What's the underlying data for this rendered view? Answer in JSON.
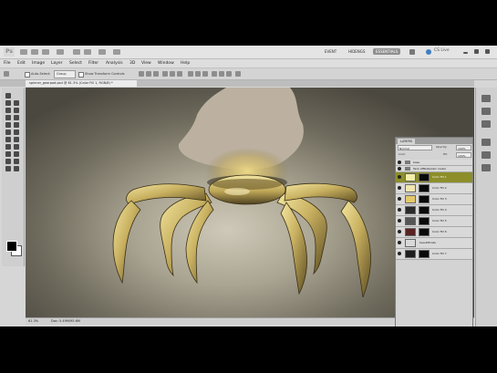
{
  "app": {
    "logo": "Ps",
    "workspaces": [
      "EVENT",
      "HIDENGS",
      "ESSENTIALS"
    ],
    "active_workspace": "ESSENTIALS",
    "cs_live": "CS Live"
  },
  "menu": [
    "File",
    "Edit",
    "Image",
    "Layer",
    "Select",
    "Filter",
    "Analysis",
    "3D",
    "View",
    "Window",
    "Help"
  ],
  "options": {
    "auto_select_label": "Auto-Select:",
    "auto_select_value": "Group",
    "show_transform_label": "Show Transform Controls"
  },
  "document": {
    "tab_title": "spinner_gearpad.psd @ 61.3% (Color Fill 1, RGB/8) *",
    "zoom": "61.3%",
    "doc_info": "Doc: 5.49M/95.6M"
  },
  "layers_panel": {
    "tab": "LAYERS",
    "blend_mode": "Normal",
    "opacity_label": "Opacity:",
    "opacity_value": "100%",
    "lock_label": "Lock:",
    "fill_label": "Fill:",
    "fill_value": "100%",
    "folders": [
      {
        "name": "base"
      },
      {
        "name": "Tank affiliate/skin metal"
      }
    ],
    "rows": [
      {
        "name": "Color Fill 1",
        "selected": true,
        "thumb_color": "#f3eeaa"
      },
      {
        "name": "Color Fill 2",
        "selected": false,
        "thumb_color": "#f1e6b0"
      },
      {
        "name": "Color Fill 3",
        "selected": false,
        "thumb_color": "#e4c86a"
      },
      {
        "name": "Color Fill 4",
        "selected": false,
        "thumb_color": "#2a2a2a"
      },
      {
        "name": "Color Fill 5",
        "selected": false,
        "thumb_color": "#555555"
      },
      {
        "name": "Color Fill 6",
        "selected": false,
        "thumb_color": "#5a2222"
      },
      {
        "name": "beautificate",
        "selected": false,
        "thumb_color": "#d9d9d9"
      },
      {
        "name": "Color Fill 7",
        "selected": false,
        "thumb_color": "#1e1e1e"
      }
    ]
  },
  "colors": {
    "selected_layer": "#8d8e2a",
    "gold_highlight": "#e6d27a",
    "gold_mid": "#b9a45a",
    "gold_dark": "#6b5a2a"
  }
}
